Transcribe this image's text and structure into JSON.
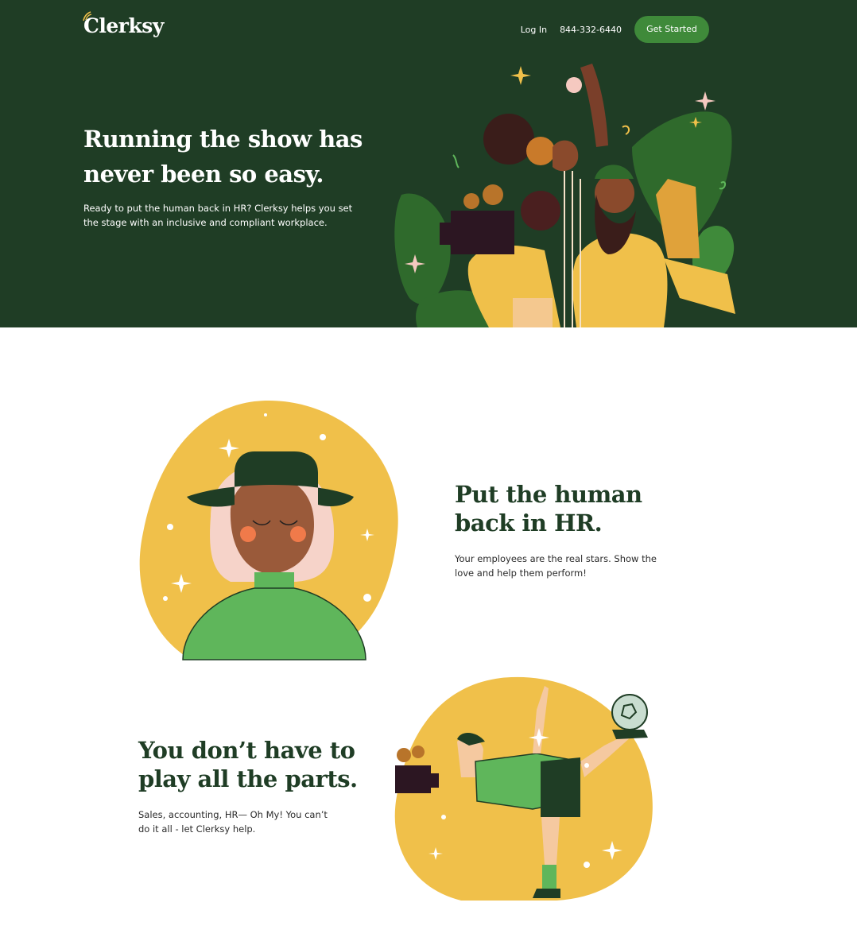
{
  "brand": {
    "name": "Clerksy"
  },
  "nav": {
    "login_label": "Log In",
    "phone": "844-332-6440",
    "cta_label": "Get Started"
  },
  "hero": {
    "title": "Running the show has never been so easy.",
    "subtitle": "Ready to put the human back in HR? Clerksy helps you set the stage with an inclusive and compliant workplace."
  },
  "features": [
    {
      "title": "Put the human back in HR.",
      "text": "Your employees are the real stars. Show the love and help them perform!"
    },
    {
      "title": "You don’t have to play all the parts.",
      "text": "Sales, accounting, HR— Oh My! You can’t do it all - let Clerksy help."
    }
  ],
  "colors": {
    "dark_green": "#1f3d25",
    "button_green": "#3f8a3a",
    "yellow": "#f0c04a",
    "light_green": "#5fb65b"
  },
  "icons": [
    "wheat-logo-icon"
  ]
}
